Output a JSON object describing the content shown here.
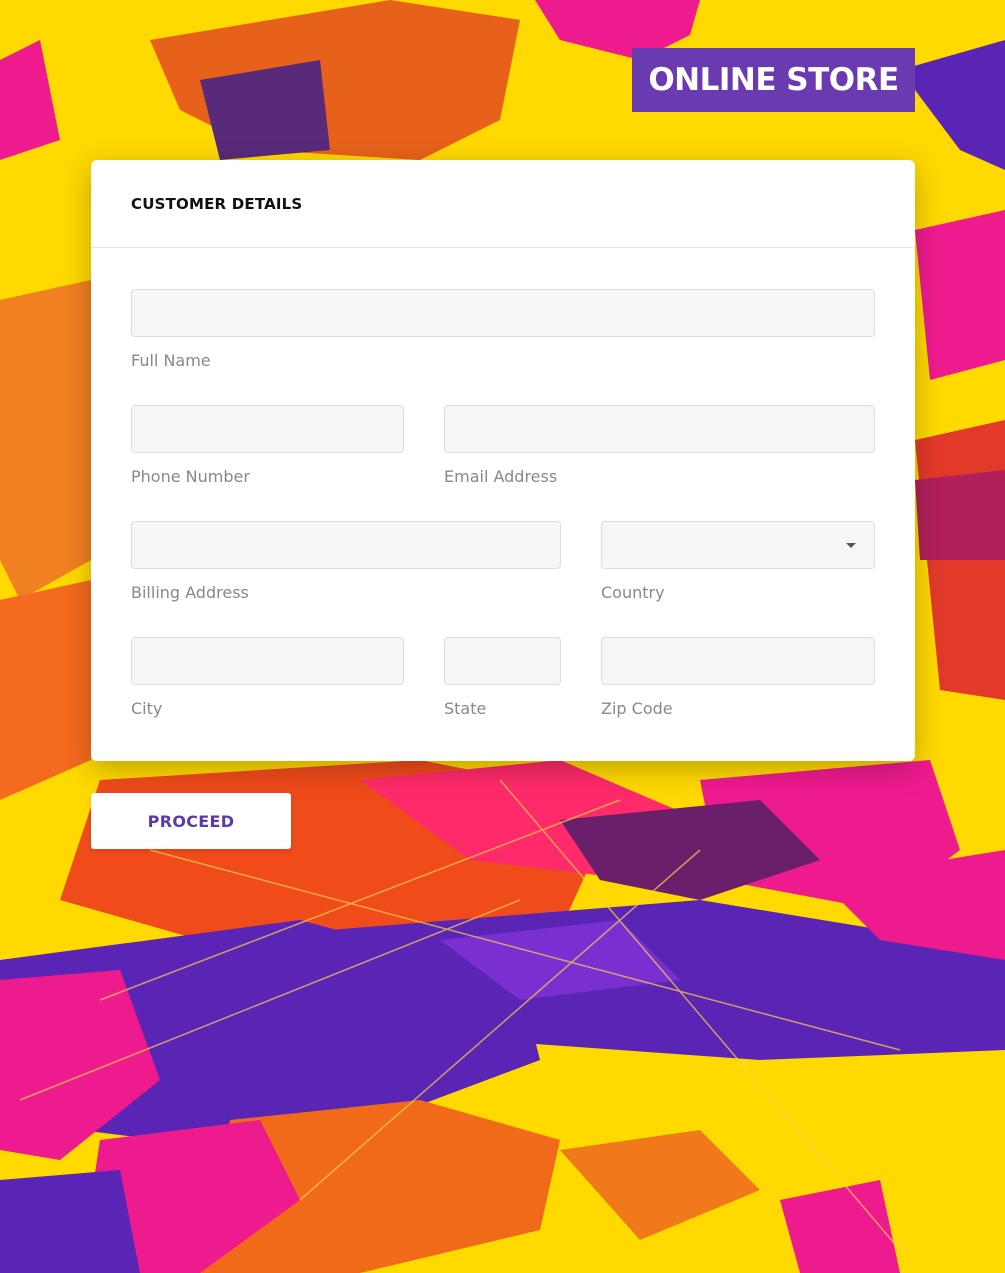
{
  "brand": {
    "title": "ONLINE STORE"
  },
  "form": {
    "title": "CUSTOMER DETAILS",
    "fields": {
      "full_name": {
        "label": "Full Name",
        "value": ""
      },
      "phone": {
        "label": "Phone Number",
        "value": ""
      },
      "email": {
        "label": "Email Address",
        "value": ""
      },
      "billing_address": {
        "label": "Billing Address",
        "value": ""
      },
      "country": {
        "label": "Country",
        "value": ""
      },
      "city": {
        "label": "City",
        "value": ""
      },
      "state": {
        "label": "State",
        "value": ""
      },
      "zip": {
        "label": "Zip Code",
        "value": ""
      }
    }
  },
  "actions": {
    "proceed_label": "PROCEED"
  },
  "colors": {
    "background_yellow": "#ffd900",
    "brand_purple": "#6a3ab0",
    "accent_magenta": "#ee1b8f",
    "accent_violet": "#5a24b4"
  },
  "icons": {
    "country_dropdown": "chevron-down-icon"
  }
}
